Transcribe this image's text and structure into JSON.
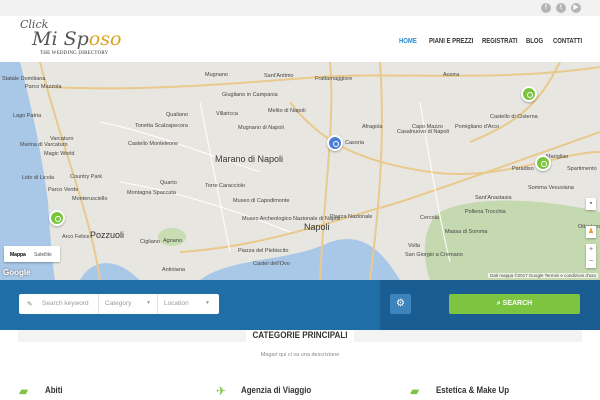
{
  "social": {
    "icons": [
      "facebook-icon",
      "twitter-icon",
      "youtube-icon"
    ],
    "glyphs": [
      "f",
      "t",
      "▶"
    ]
  },
  "logo": {
    "line1": "Click",
    "line2a": "Mi Sp",
    "line2b": "oso",
    "tagline": "THE WEDDING DIRECTORY"
  },
  "nav": [
    {
      "label": "HOME",
      "active": true
    },
    {
      "label": "PIANI E PREZZI"
    },
    {
      "label": "REGISTRATI"
    },
    {
      "label": "BLOG"
    },
    {
      "label": "CONTATTI"
    }
  ],
  "map": {
    "places": [
      "Statale Domitiana",
      "Parco Mazzola",
      "Lago Patria",
      "Varcaturo",
      "Marina di Varcaturo",
      "Magic World",
      "Lido di Licola",
      "Country Park",
      "Parco Verde",
      "Monterusciello",
      "Arco Felice",
      "Pozzuoli",
      "Giugliano in Campania",
      "Qualiano",
      "Villaricca",
      "Tonetta Scalzapecora",
      "Mugnano di Napoli",
      "Castello Monteleone",
      "Marano di Napoli",
      "Quarto",
      "Montagna Spaccata",
      "Torre Caracciolo",
      "Cigliano",
      "Agnano",
      "Museo di Capodimonte",
      "Museo Archeologico Nazionale di Napoli",
      "Piazza del Plebiscito",
      "Castel dell'Ovo",
      "Antiniana",
      "Afragola",
      "Casoria",
      "Casalnuovo di Napoli",
      "Capo Mazzo",
      "Pomigliano d'Arco",
      "Acerra",
      "Castello di Cisterna",
      "Mariglian",
      "Napoli",
      "Piazza Nazionale",
      "Volla",
      "Cercola",
      "San Giorgio a Cremano",
      "Massa di Somma",
      "Pollena Trocchia",
      "Sant'Anastasia",
      "Somma Vesuviana",
      "Paradiso",
      "Spartimento",
      "Ottaviano",
      "Sant'Antimo",
      "Mugnano",
      "Frattamaggiore",
      "Melito di Napoli"
    ],
    "maptype": {
      "map": "Mappa",
      "satellite": "Satellite"
    },
    "google": "Google",
    "attribution": "Dati mappa ©2017 Google   Termini e condizioni d'uso",
    "zoom_in": "+",
    "zoom_out": "−"
  },
  "search": {
    "keyword_placeholder": "Search keyword",
    "category": "Category",
    "location": "Location",
    "button": "SEARCH"
  },
  "categories": {
    "title": "CATEGORIE PRINCIPALI",
    "description": "Magari qui ci va una descrizione",
    "items": [
      {
        "label": "Abiti",
        "icon": "folder-open-icon"
      },
      {
        "label": "Agenzia di Viaggio",
        "icon": "plane-icon"
      },
      {
        "label": "Estetica & Make Up",
        "icon": "folder-open-icon"
      }
    ]
  },
  "colors": {
    "accent": "#2a8ad0",
    "green": "#7dc441",
    "blue_bar": "#1f6ea8"
  }
}
